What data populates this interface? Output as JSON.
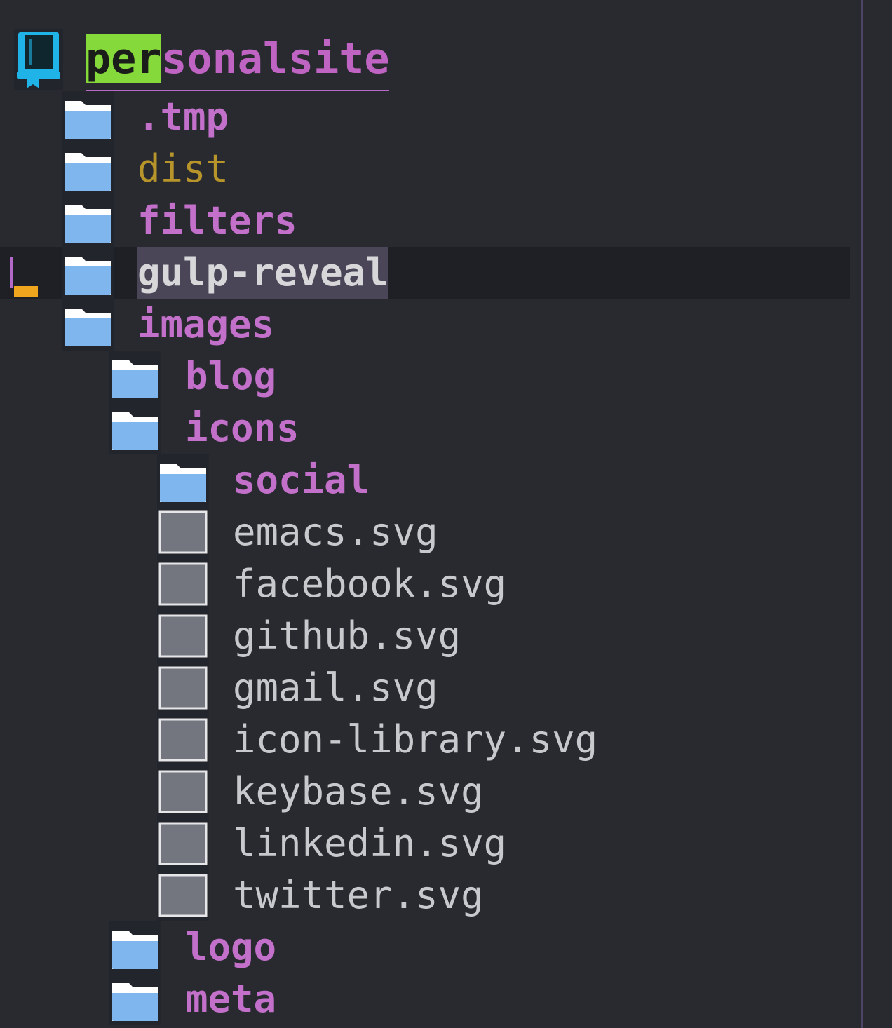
{
  "root": {
    "name_highlight": "per",
    "name_rest": "sonalsite"
  },
  "entries": [
    {
      "name": ".tmp",
      "kind": "dir",
      "depth": 1
    },
    {
      "name": "dist",
      "kind": "dir",
      "depth": 1,
      "ignored": true
    },
    {
      "name": "filters",
      "kind": "dir",
      "depth": 1
    },
    {
      "name": "gulp-reveal",
      "kind": "dir",
      "depth": 1,
      "selected": true
    },
    {
      "name": "images",
      "kind": "dir",
      "depth": 1
    },
    {
      "name": "blog",
      "kind": "dir",
      "depth": 2
    },
    {
      "name": "icons",
      "kind": "dir",
      "depth": 2
    },
    {
      "name": "social",
      "kind": "dir",
      "depth": 3
    },
    {
      "name": "emacs.svg",
      "kind": "file",
      "depth": 3
    },
    {
      "name": "facebook.svg",
      "kind": "file",
      "depth": 3
    },
    {
      "name": "github.svg",
      "kind": "file",
      "depth": 3
    },
    {
      "name": "gmail.svg",
      "kind": "file",
      "depth": 3
    },
    {
      "name": "icon-library.svg",
      "kind": "file",
      "depth": 3
    },
    {
      "name": "keybase.svg",
      "kind": "file",
      "depth": 3
    },
    {
      "name": "linkedin.svg",
      "kind": "file",
      "depth": 3
    },
    {
      "name": "twitter.svg",
      "kind": "file",
      "depth": 3
    },
    {
      "name": "logo",
      "kind": "dir",
      "depth": 2
    },
    {
      "name": "meta",
      "kind": "dir",
      "depth": 2
    }
  ],
  "colors": {
    "background": "#282a30",
    "directory": "#c270c9",
    "ignored": "#b7952a",
    "file": "#c8c9cc",
    "root_highlight": "#86d93a",
    "folder_icon": "#7fb6ee",
    "cursor_marker": "#f0a51f"
  },
  "icons": {
    "root": "book-icon",
    "dir": "folder-icon",
    "file": "file-icon"
  }
}
